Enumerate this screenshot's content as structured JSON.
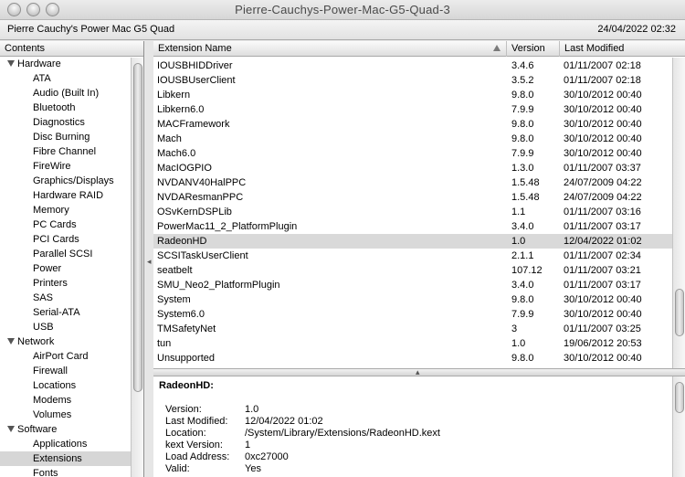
{
  "window": {
    "title": "Pierre-Cauchys-Power-Mac-G5-Quad-3",
    "machine_name": "Pierre Cauchy's Power Mac G5 Quad",
    "datetime": "24/04/2022 02:32"
  },
  "sidebar": {
    "header": "Contents",
    "groups": [
      {
        "label": "Hardware",
        "items": [
          "ATA",
          "Audio (Built In)",
          "Bluetooth",
          "Diagnostics",
          "Disc Burning",
          "Fibre Channel",
          "FireWire",
          "Graphics/Displays",
          "Hardware RAID",
          "Memory",
          "PC Cards",
          "PCI Cards",
          "Parallel SCSI",
          "Power",
          "Printers",
          "SAS",
          "Serial-ATA",
          "USB"
        ]
      },
      {
        "label": "Network",
        "items": [
          "AirPort Card",
          "Firewall",
          "Locations",
          "Modems",
          "Volumes"
        ]
      },
      {
        "label": "Software",
        "items": [
          "Applications",
          "Extensions",
          "Fonts"
        ]
      }
    ],
    "selected": "Extensions"
  },
  "table": {
    "columns": {
      "name": "Extension Name",
      "version": "Version",
      "modified": "Last Modified"
    },
    "rows": [
      {
        "name": "IOUSBHIDDriver",
        "version": "3.4.6",
        "modified": "01/11/2007 02:18"
      },
      {
        "name": "IOUSBUserClient",
        "version": "3.5.2",
        "modified": "01/11/2007 02:18"
      },
      {
        "name": "Libkern",
        "version": "9.8.0",
        "modified": "30/10/2012 00:40"
      },
      {
        "name": "Libkern6.0",
        "version": "7.9.9",
        "modified": "30/10/2012 00:40"
      },
      {
        "name": "MACFramework",
        "version": "9.8.0",
        "modified": "30/10/2012 00:40"
      },
      {
        "name": "Mach",
        "version": "9.8.0",
        "modified": "30/10/2012 00:40"
      },
      {
        "name": "Mach6.0",
        "version": "7.9.9",
        "modified": "30/10/2012 00:40"
      },
      {
        "name": "MacIOGPIO",
        "version": "1.3.0",
        "modified": "01/11/2007 03:37"
      },
      {
        "name": "NVDANV40HalPPC",
        "version": "1.5.48",
        "modified": "24/07/2009 04:22"
      },
      {
        "name": "NVDAResmanPPC",
        "version": "1.5.48",
        "modified": "24/07/2009 04:22"
      },
      {
        "name": "OSvKernDSPLib",
        "version": "1.1",
        "modified": "01/11/2007 03:16"
      },
      {
        "name": "PowerMac11_2_PlatformPlugin",
        "version": "3.4.0",
        "modified": "01/11/2007 03:17"
      },
      {
        "name": "RadeonHD",
        "version": "1.0",
        "modified": "12/04/2022 01:02"
      },
      {
        "name": "SCSITaskUserClient",
        "version": "2.1.1",
        "modified": "01/11/2007 02:34"
      },
      {
        "name": "seatbelt",
        "version": "107.12",
        "modified": "01/11/2007 03:21"
      },
      {
        "name": "SMU_Neo2_PlatformPlugin",
        "version": "3.4.0",
        "modified": "01/11/2007 03:17"
      },
      {
        "name": "System",
        "version": "9.8.0",
        "modified": "30/10/2012 00:40"
      },
      {
        "name": "System6.0",
        "version": "7.9.9",
        "modified": "30/10/2012 00:40"
      },
      {
        "name": "TMSafetyNet",
        "version": "3",
        "modified": "01/11/2007 03:25"
      },
      {
        "name": "tun",
        "version": "1.0",
        "modified": "19/06/2012 20:53"
      },
      {
        "name": "Unsupported",
        "version": "9.8.0",
        "modified": "30/10/2012 00:40"
      }
    ],
    "selected": "RadeonHD"
  },
  "detail": {
    "title": "RadeonHD:",
    "fields": [
      {
        "label": "Version:",
        "value": "1.0"
      },
      {
        "label": "Last Modified:",
        "value": "12/04/2022 01:02"
      },
      {
        "label": "Location:",
        "value": "/System/Library/Extensions/RadeonHD.kext"
      },
      {
        "label": "kext Version:",
        "value": "1"
      },
      {
        "label": "Load Address:",
        "value": "0xc27000"
      },
      {
        "label": "Valid:",
        "value": "Yes"
      }
    ]
  }
}
